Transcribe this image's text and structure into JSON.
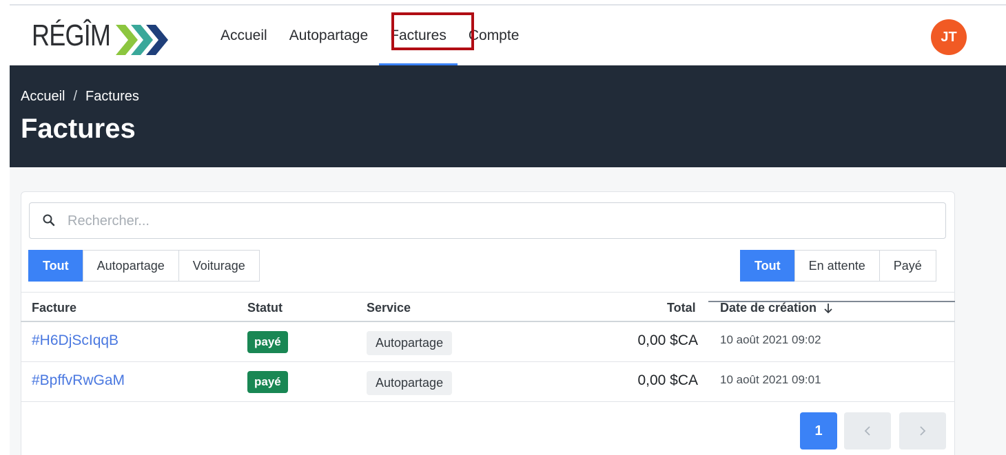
{
  "brand": {
    "name": "RÉGÎM",
    "colors": {
      "chevron_green": "#8cc63f",
      "chevron_blue": "#1f3f7a"
    }
  },
  "nav": {
    "items": [
      {
        "label": "Accueil"
      },
      {
        "label": "Autopartage"
      },
      {
        "label": "Factures",
        "active": true
      },
      {
        "label": "Compte"
      }
    ]
  },
  "user": {
    "initials": "JT",
    "avatar_color": "#f15a24"
  },
  "breadcrumb": {
    "home": "Accueil",
    "separator": "/",
    "current": "Factures"
  },
  "page": {
    "title": "Factures"
  },
  "search": {
    "placeholder": "Rechercher...",
    "value": ""
  },
  "filters": {
    "service": {
      "options": [
        "Tout",
        "Autopartage",
        "Voiturage"
      ],
      "selected": "Tout"
    },
    "status": {
      "options": [
        "Tout",
        "En attente",
        "Payé"
      ],
      "selected": "Tout"
    }
  },
  "table": {
    "headers": {
      "invoice": "Facture",
      "status": "Statut",
      "service": "Service",
      "total": "Total",
      "created": "Date de création",
      "sort_icon": "arrow-down-icon"
    },
    "rows": [
      {
        "invoice": "#H6DjScIqqB",
        "status": "payé",
        "service": "Autopartage",
        "total": "0,00 $CA",
        "created": "10 août 2021 09:02"
      },
      {
        "invoice": "#BpffvRwGaM",
        "status": "payé",
        "service": "Autopartage",
        "total": "0,00 $CA",
        "created": "10 août 2021 09:01"
      }
    ]
  },
  "pagination": {
    "current": "1",
    "prev_icon": "chevron-left-icon",
    "next_icon": "chevron-right-icon"
  },
  "colors": {
    "accent": "#3b82f6",
    "banner": "#212b38",
    "success": "#198754",
    "highlight": "#b10d14"
  }
}
